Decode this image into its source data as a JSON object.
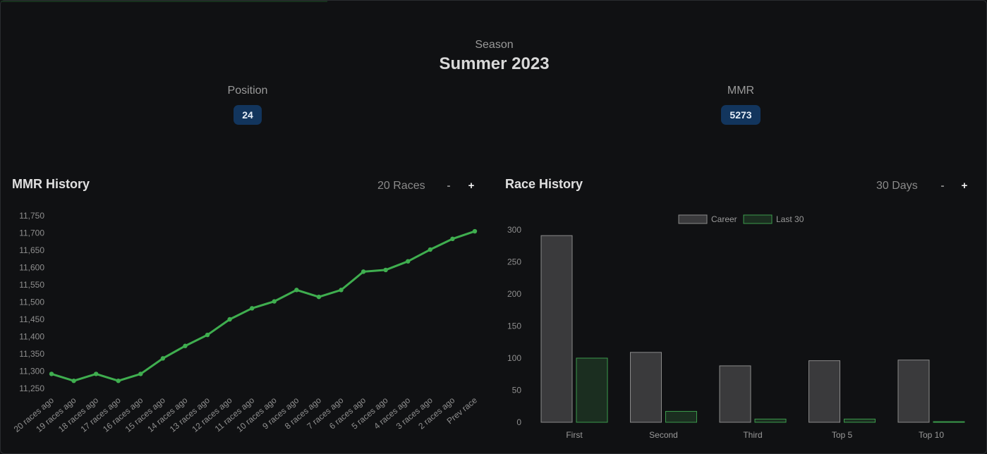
{
  "season": {
    "label": "Season",
    "name": "Summer 2023"
  },
  "stats": {
    "position": {
      "label": "Position",
      "value": "24"
    },
    "mmr": {
      "label": "MMR",
      "value": "5273"
    }
  },
  "mmr_history": {
    "title": "MMR History",
    "range_label": "20 Races",
    "minus_label": "-",
    "plus_label": "+"
  },
  "race_history": {
    "title": "Race History",
    "range_label": "30 Days",
    "minus_label": "-",
    "plus_label": "+"
  },
  "colors": {
    "line": "#3fae4f",
    "career_fill": "#3a3a3c",
    "career_stroke": "#8a8a8a",
    "last30_fill": "#1b2e20",
    "last30_stroke": "#3b9a4b",
    "badge": "#12355d"
  },
  "chart_data": [
    {
      "type": "line",
      "title": "MMR History",
      "categories": [
        "20 races ago",
        "19 races ago",
        "18 races ago",
        "17 races ago",
        "16 races ago",
        "15 races ago",
        "14 races ago",
        "13 races ago",
        "12 races ago",
        "11 races ago",
        "10 races ago",
        "9 races ago",
        "8 races ago",
        "7 races ago",
        "6 races ago",
        "5 races ago",
        "4 races ago",
        "3 races ago",
        "2 races ago",
        "Prev race"
      ],
      "series": [
        {
          "values": [
            11292,
            11272,
            11292,
            11272,
            11292,
            11337,
            11373,
            11405,
            11450,
            11482,
            11502,
            11535,
            11515,
            11535,
            11588,
            11593,
            11618,
            11652,
            11683,
            11705
          ]
        }
      ],
      "yticks": [
        "11,250",
        "11,300",
        "11,350",
        "11,400",
        "11,450",
        "11,500",
        "11,550",
        "11,600",
        "11,650",
        "11,700",
        "11,750"
      ],
      "ylim": [
        11250,
        11750
      ],
      "grid": false
    },
    {
      "type": "bar",
      "title": "Race History",
      "categories": [
        "First",
        "Second",
        "Third",
        "Top 5",
        "Top 10"
      ],
      "series": [
        {
          "name": "Career",
          "values": [
            291,
            109,
            88,
            96,
            97
          ]
        },
        {
          "name": "Last 30",
          "values": [
            100,
            17,
            5,
            5,
            1
          ]
        }
      ],
      "yticks": [
        "0",
        "50",
        "100",
        "150",
        "200",
        "250",
        "300"
      ],
      "ylim": [
        0,
        300
      ],
      "legend": "top-center",
      "grid": false
    }
  ]
}
